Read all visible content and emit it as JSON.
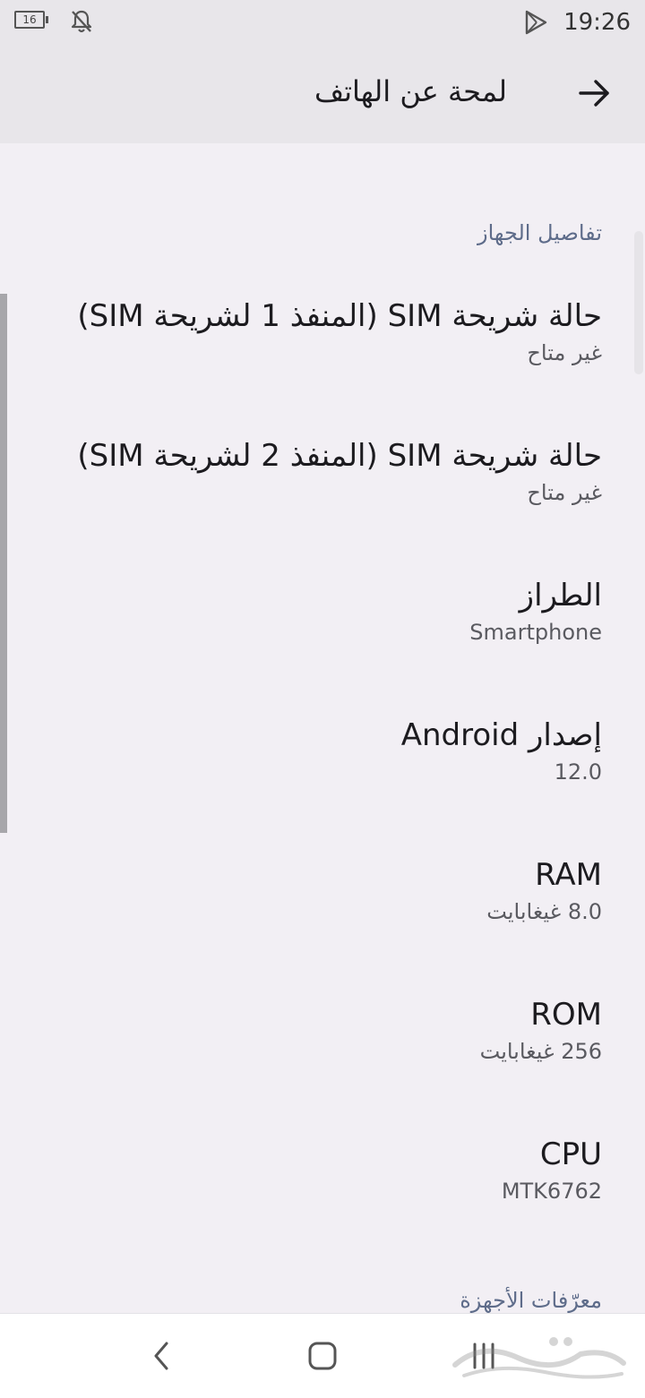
{
  "status_bar": {
    "battery_level": "16",
    "time": "19:26",
    "icons": [
      "battery-icon",
      "bell-off-icon",
      "play-triangle-icon"
    ]
  },
  "app_bar": {
    "title": "لمحة عن الهاتف",
    "back_icon": "arrow-right-icon"
  },
  "section_device": {
    "header": "تفاصيل الجهاز",
    "items": [
      {
        "title": "حالة شريحة SIM (المنفذ 1 لشريحة SIM)",
        "summary": "غير متاح"
      },
      {
        "title": "حالة شريحة SIM (المنفذ 2 لشريحة SIM)",
        "summary": "غير متاح"
      },
      {
        "title": "الطراز",
        "summary": "Smartphone"
      },
      {
        "title": "إصدار Android",
        "summary": "12.0"
      },
      {
        "title": "RAM",
        "summary": "8.0 غيغابايت"
      },
      {
        "title": "ROM",
        "summary": "256 غيغابايت"
      },
      {
        "title": "CPU",
        "summary": "MTK6762"
      }
    ]
  },
  "section_identifiers": {
    "header": "معرّفات الأجهزة"
  },
  "nav_bar": {
    "icons": [
      "back-chevron-icon",
      "home-icon",
      "recents-icon"
    ]
  },
  "colors": {
    "background": "#f2eff4",
    "app_bar": "#e8e6ea",
    "section_header": "#5e6c8a",
    "summary_text": "#5a5a60"
  }
}
